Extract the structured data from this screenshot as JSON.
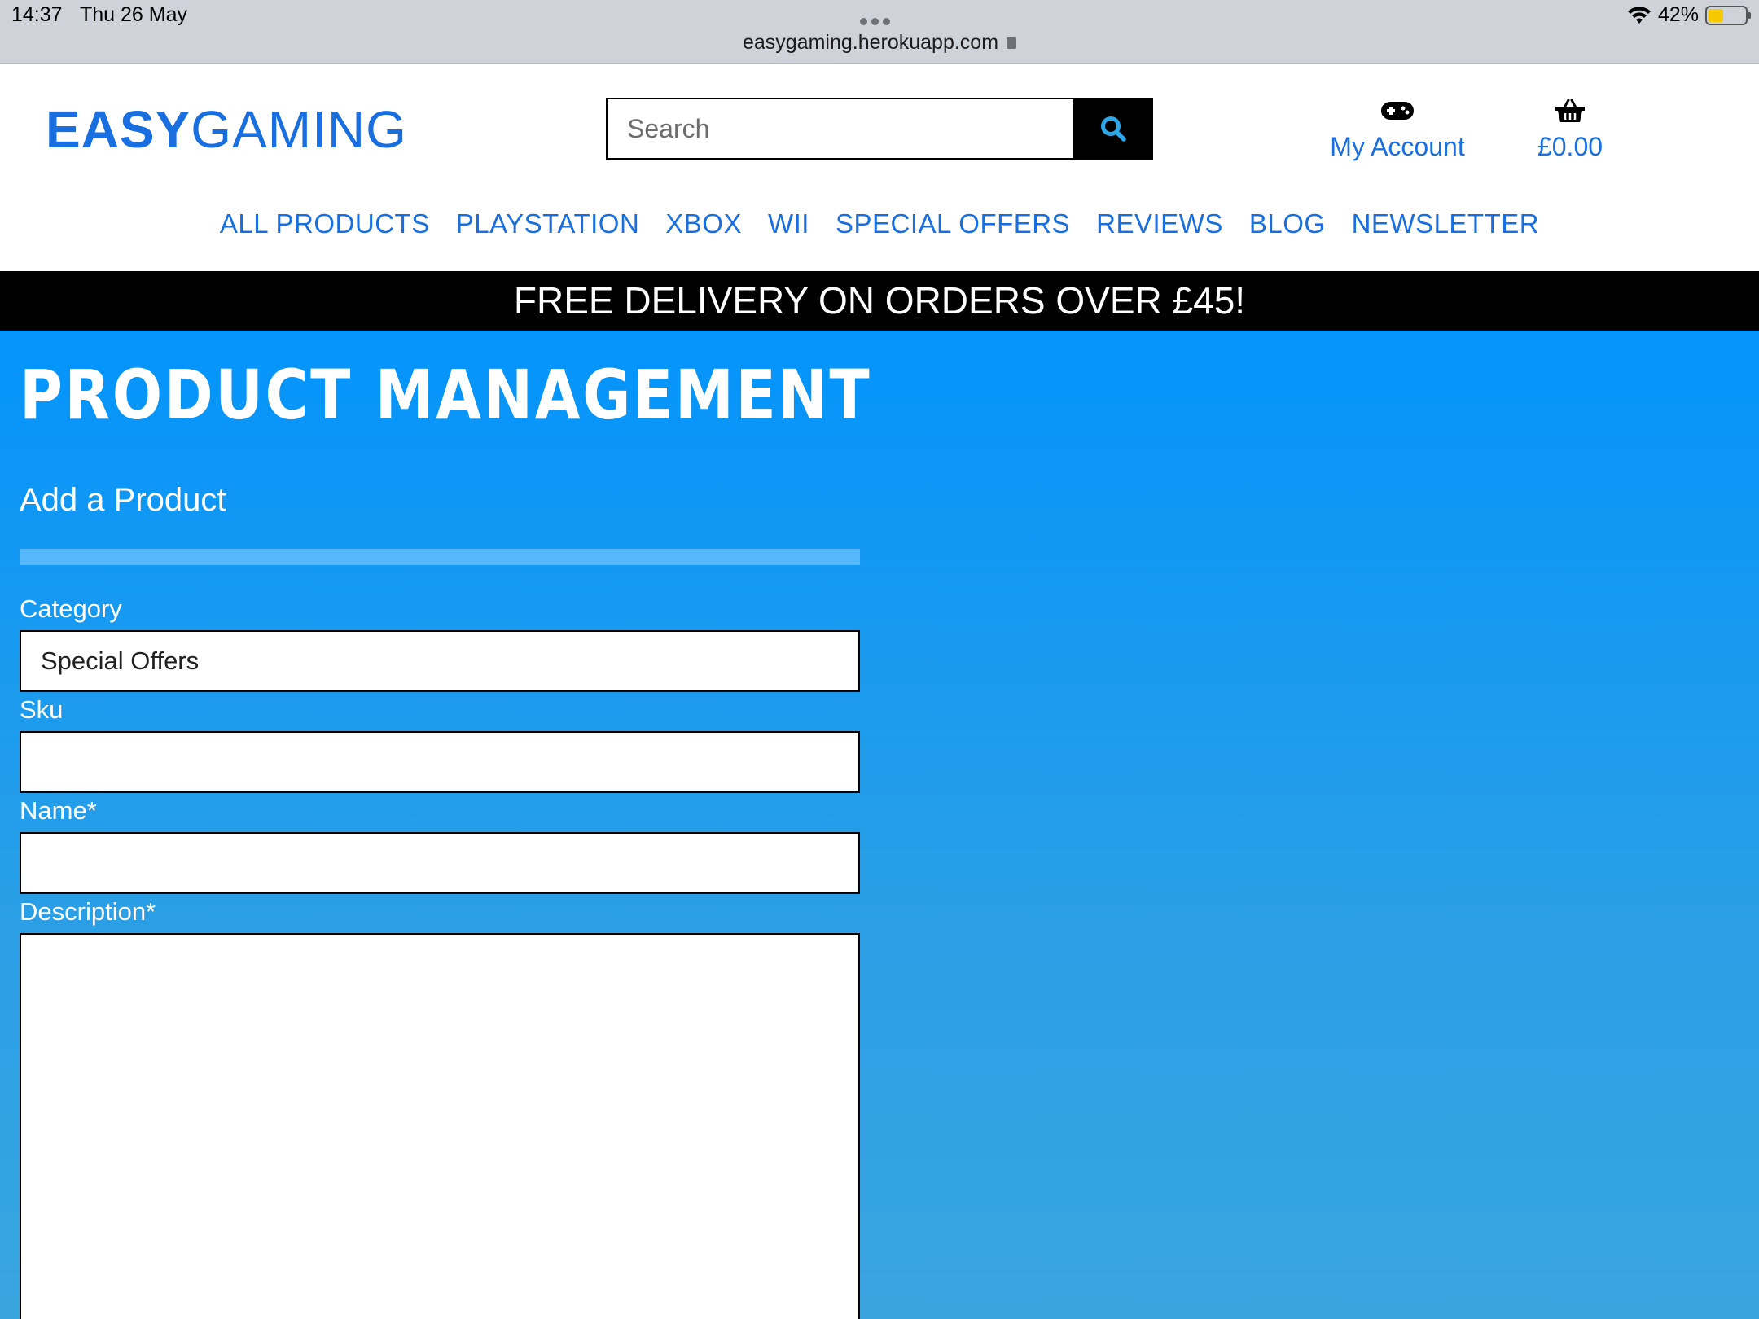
{
  "status_bar": {
    "time": "14:37",
    "date": "Thu 26 May",
    "url": "easygaming.herokuapp.com",
    "battery": "42%",
    "battery_level": 0.42
  },
  "header": {
    "logo_bold": "EASY",
    "logo_light": "GAMING",
    "search_placeholder": "Search",
    "account_label": "My Account",
    "basket_total": "£0.00",
    "brand_color": "#1a6fe0"
  },
  "nav": {
    "items": [
      {
        "label": "ALL PRODUCTS"
      },
      {
        "label": "PLAYSTATION"
      },
      {
        "label": "XBOX"
      },
      {
        "label": "WII"
      },
      {
        "label": "SPECIAL OFFERS"
      },
      {
        "label": "REVIEWS"
      },
      {
        "label": "BLOG"
      },
      {
        "label": "NEWSLETTER"
      }
    ]
  },
  "banner": {
    "text": "FREE DELIVERY ON ORDERS OVER £45!"
  },
  "main": {
    "title": "PRODUCT MANAGEMENT",
    "subtitle": "Add a Product",
    "form": {
      "category_label": "Category",
      "category_value": "Special Offers",
      "sku_label": "Sku",
      "sku_value": "",
      "name_label": "Name*",
      "name_value": "",
      "description_label": "Description*",
      "description_value": ""
    }
  }
}
